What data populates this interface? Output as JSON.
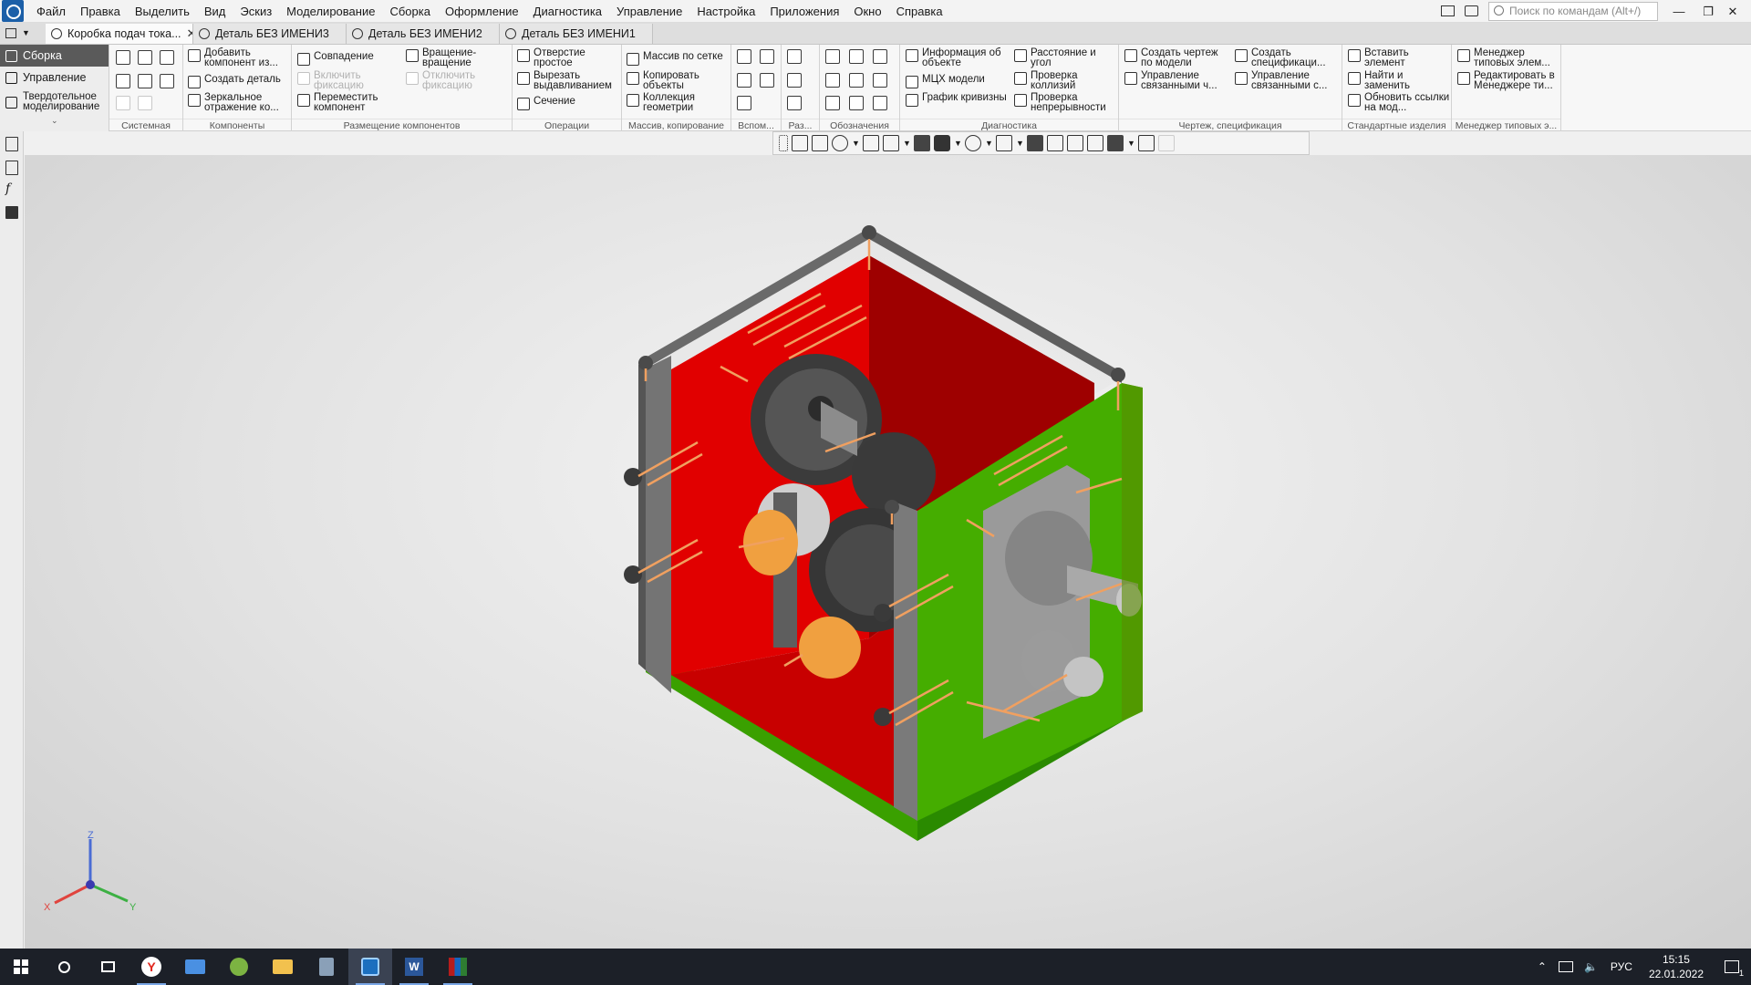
{
  "menu": [
    "Файл",
    "Правка",
    "Выделить",
    "Вид",
    "Эскиз",
    "Моделирование",
    "Сборка",
    "Оформление",
    "Диагностика",
    "Управление",
    "Настройка",
    "Приложения",
    "Окно",
    "Справка"
  ],
  "search": {
    "placeholder": "Поиск по командам (Alt+/)"
  },
  "tabs": [
    {
      "label": "Коробка подач тока...",
      "active": true
    },
    {
      "label": "Деталь БЕЗ ИМЕНИ3"
    },
    {
      "label": "Деталь БЕЗ ИМЕНИ2"
    },
    {
      "label": "Деталь БЕЗ ИМЕНИ1"
    }
  ],
  "modes": [
    "Сборка",
    "Управление",
    "Твердотельное моделирование"
  ],
  "ribbon": {
    "groups": [
      "Системная",
      "Компоненты",
      "Размещение компонентов",
      "Операции",
      "Массив, копирование",
      "Вспом...",
      "Раз...",
      "Обозначения",
      "Диагностика",
      "Чертеж, спецификация",
      "Стандартные изделия",
      "Менеджер типовых э..."
    ],
    "components": [
      "Добавить компонент из...",
      "Создать деталь",
      "Зеркальное отражение ко..."
    ],
    "placement": [
      "Совпадение",
      "Включить фиксацию",
      "Переместить компонент",
      "Вращение-вращение",
      "Отключить фиксацию"
    ],
    "operations": [
      "Отверстие простое",
      "Вырезать выдавливанием",
      "Сечение"
    ],
    "array": [
      "Массив по сетке",
      "Копировать объекты",
      "Коллекция геометрии"
    ],
    "diagnostics": [
      "Информация об объекте",
      "МЦХ модели",
      "График кривизны",
      "Расстояние и угол",
      "Проверка коллизий",
      "Проверка непрерывности"
    ],
    "drawing": [
      "Создать чертеж по модели",
      "Управление связанными ч...",
      "Создать спецификаци...",
      "Управление связанными с..."
    ],
    "standard": [
      "Вставить элемент",
      "Найти и заменить",
      "Обновить ссылки на мод..."
    ],
    "manager": [
      "Менеджер типовых элем...",
      "Редактировать в Менеджере ти..."
    ]
  },
  "axes": {
    "x": "X",
    "y": "Y",
    "z": "Z"
  },
  "taskbar": {
    "time": "15:15",
    "date": "22.01.2022",
    "lang": "РУС",
    "notifications": "1"
  },
  "colors": {
    "red_wall": "#e10000",
    "green_wall": "#3aa600",
    "frame": "#6e6e6e",
    "highlight": "#f0a060"
  }
}
